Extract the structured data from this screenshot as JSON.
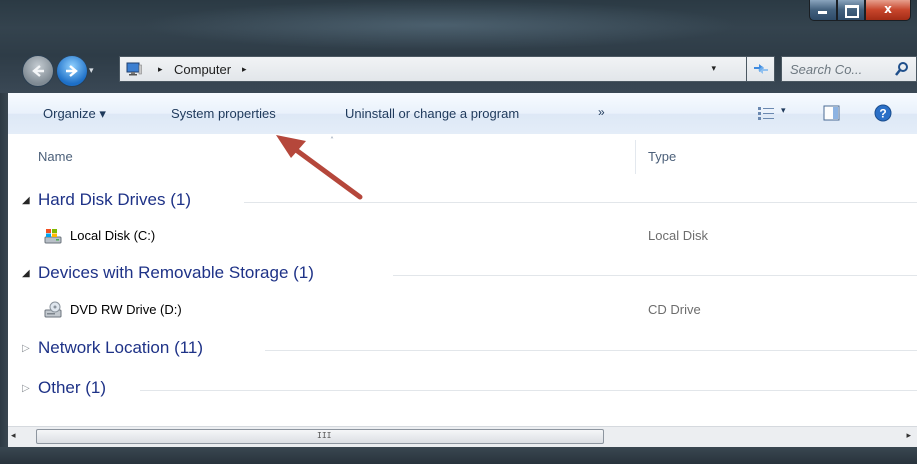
{
  "window": {
    "caption_buttons": {
      "minimize_icon": "minimize-icon",
      "maximize_icon": "maximize-icon",
      "close_glyph": "x"
    }
  },
  "nav": {
    "back_icon": "back-arrow-icon",
    "forward_icon": "forward-arrow-icon",
    "history_dropdown_icon": "chevron-down-icon"
  },
  "address": {
    "location": "Computer",
    "breadcrumb_separator": "▸",
    "dropdown_glyph": "▾"
  },
  "search": {
    "placeholder": "Search Co..."
  },
  "toolbar": {
    "organize_label": "Organize ▾",
    "system_properties_label": "System properties",
    "uninstall_label": "Uninstall or change a program",
    "more_label": "»",
    "views_dropdown_glyph": "▾"
  },
  "columns": {
    "name": "Name",
    "type": "Type",
    "sort_glyph": "˄"
  },
  "groups": [
    {
      "label": "Hard Disk Drives (1)",
      "expanded": true,
      "items": [
        {
          "name": "Local Disk (C:)",
          "type": "Local Disk",
          "icon": "hard-disk-icon"
        }
      ]
    },
    {
      "label": "Devices with Removable Storage (1)",
      "expanded": true,
      "items": [
        {
          "name": "DVD RW Drive (D:)",
          "type": "CD Drive",
          "icon": "dvd-drive-icon"
        }
      ]
    },
    {
      "label": "Network Location (11)",
      "expanded": false,
      "items": []
    },
    {
      "label": "Other (1)",
      "expanded": false,
      "items": []
    }
  ],
  "tree_glyphs": {
    "expanded": "◢",
    "collapsed": "▷"
  },
  "scrollbar": {
    "left_arrow": "◂",
    "right_arrow": "▸",
    "grip": "III"
  },
  "colors": {
    "group_heading": "#1e3287",
    "toolbar_text": "#1e395b",
    "annotation_arrow": "#b5473b",
    "frame": "#2e3c47"
  }
}
